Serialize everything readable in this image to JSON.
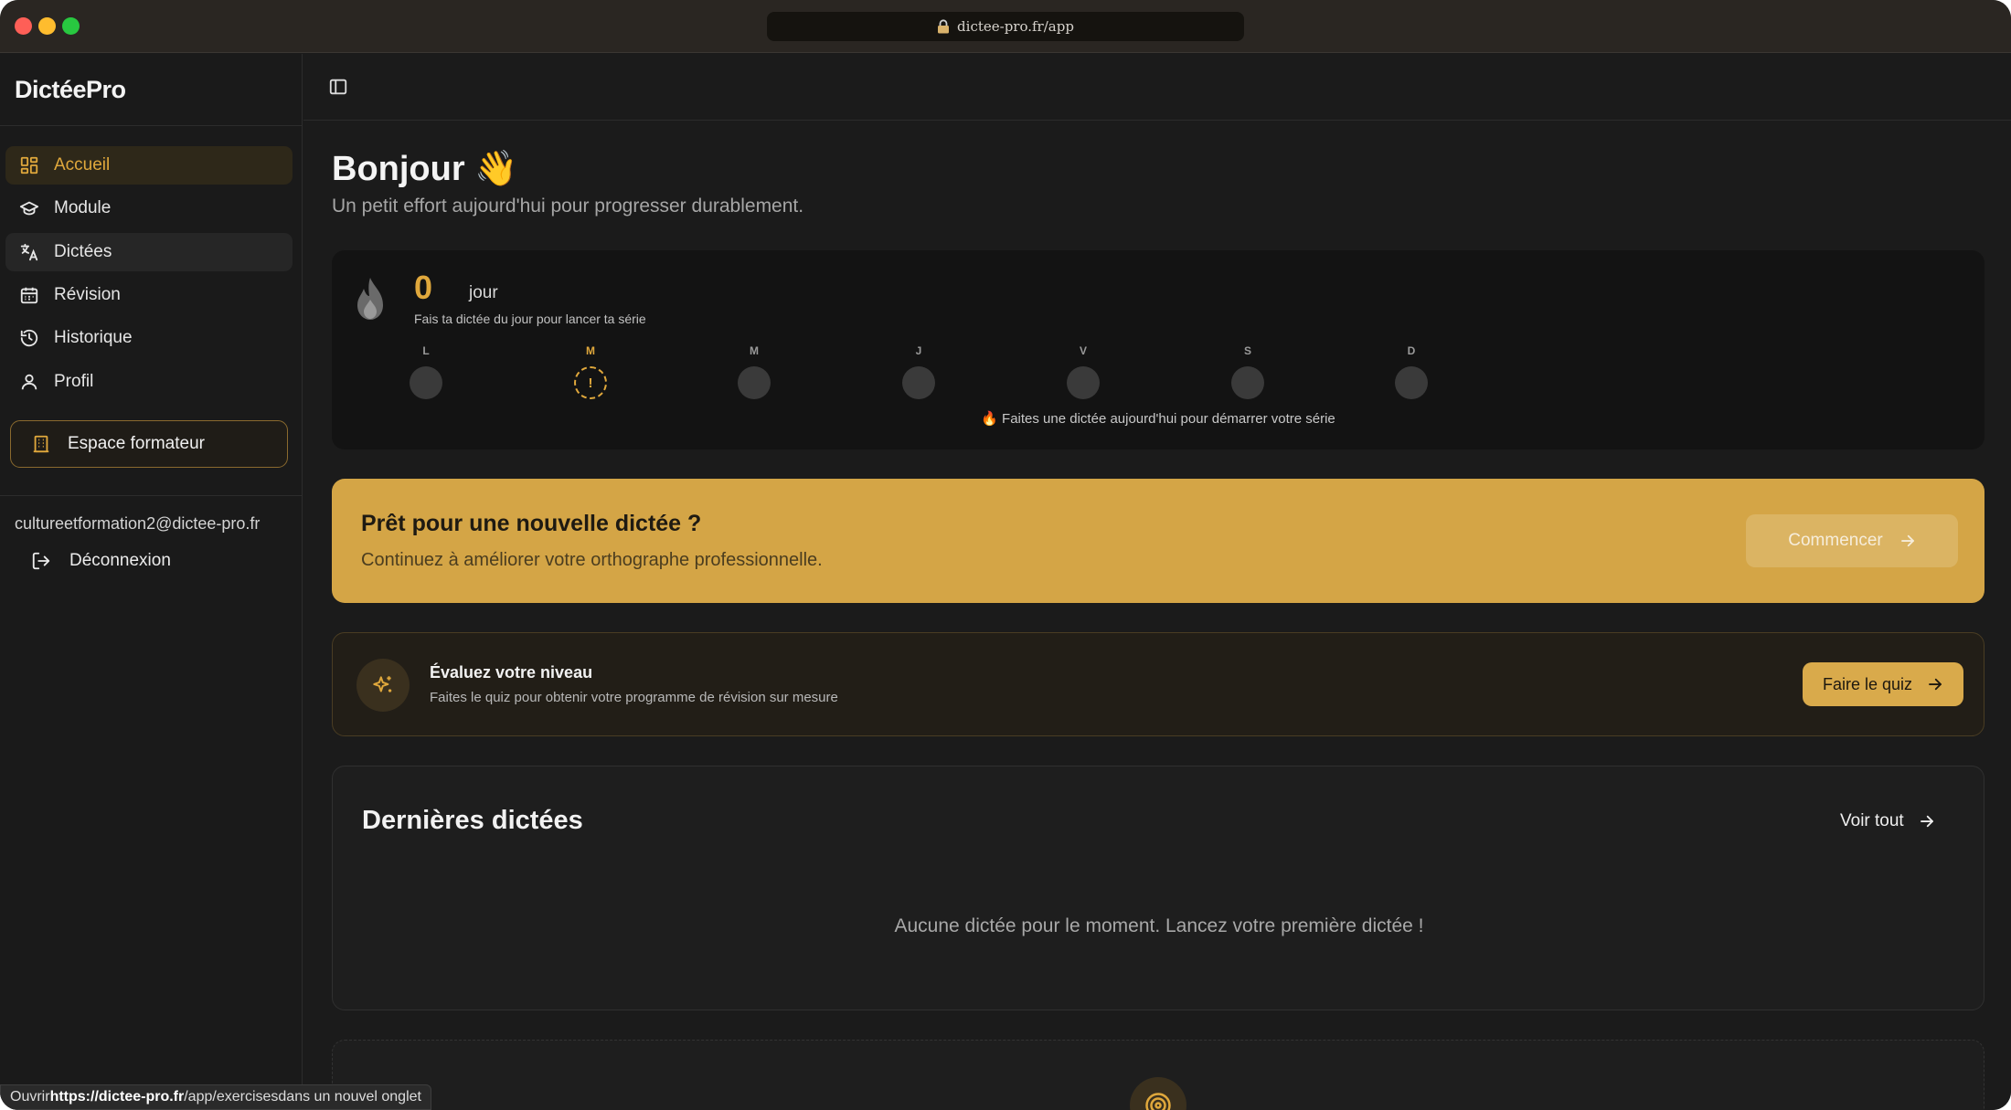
{
  "browser": {
    "url": "dictee-pro.fr/app"
  },
  "sidebar": {
    "brand": "DictéePro",
    "items": [
      {
        "label": "Accueil",
        "icon": "dashboard-icon"
      },
      {
        "label": "Module",
        "icon": "graduation-cap-icon"
      },
      {
        "label": "Dictées",
        "icon": "translate-icon"
      },
      {
        "label": "Révision",
        "icon": "calendar-icon"
      },
      {
        "label": "Historique",
        "icon": "history-icon"
      },
      {
        "label": "Profil",
        "icon": "user-icon"
      }
    ],
    "formateur_label": "Espace formateur",
    "user_email": "cultureetformation2@dictee-pro.fr",
    "logout_label": "Déconnexion"
  },
  "main": {
    "greeting": "Bonjour 👋",
    "subgreeting": "Un petit effort aujourd'hui pour progresser durablement.",
    "streak": {
      "count": "0",
      "unit": "jour",
      "hint": "Fais ta dictée du jour pour lancer ta série",
      "days": [
        "L",
        "M",
        "M",
        "J",
        "V",
        "S",
        "D"
      ],
      "today_mark": "!",
      "footer": "🔥 Faites une dictée aujourd'hui pour démarrer votre série"
    },
    "cta": {
      "title": "Prêt pour une nouvelle dictée ?",
      "subtitle": "Continuez à améliorer votre orthographe professionnelle.",
      "button": "Commencer"
    },
    "quiz": {
      "title": "Évaluez votre niveau",
      "subtitle": "Faites le quiz pour obtenir votre programme de révision sur mesure",
      "button": "Faire le quiz"
    },
    "recent": {
      "title": "Dernières dictées",
      "see_all": "Voir tout",
      "empty": "Aucune dictée pour le moment. Lancez votre première dictée !"
    }
  },
  "status_preview": {
    "prefix": "Ouvrir ",
    "link_bold": "https://dictee-pro.fr",
    "link_rest": "/app/exercises",
    "suffix": " dans un nouvel onglet"
  },
  "colors": {
    "accent": "#e0a83c",
    "cta_background": "#d4a546",
    "background": "#1b1b1b"
  }
}
